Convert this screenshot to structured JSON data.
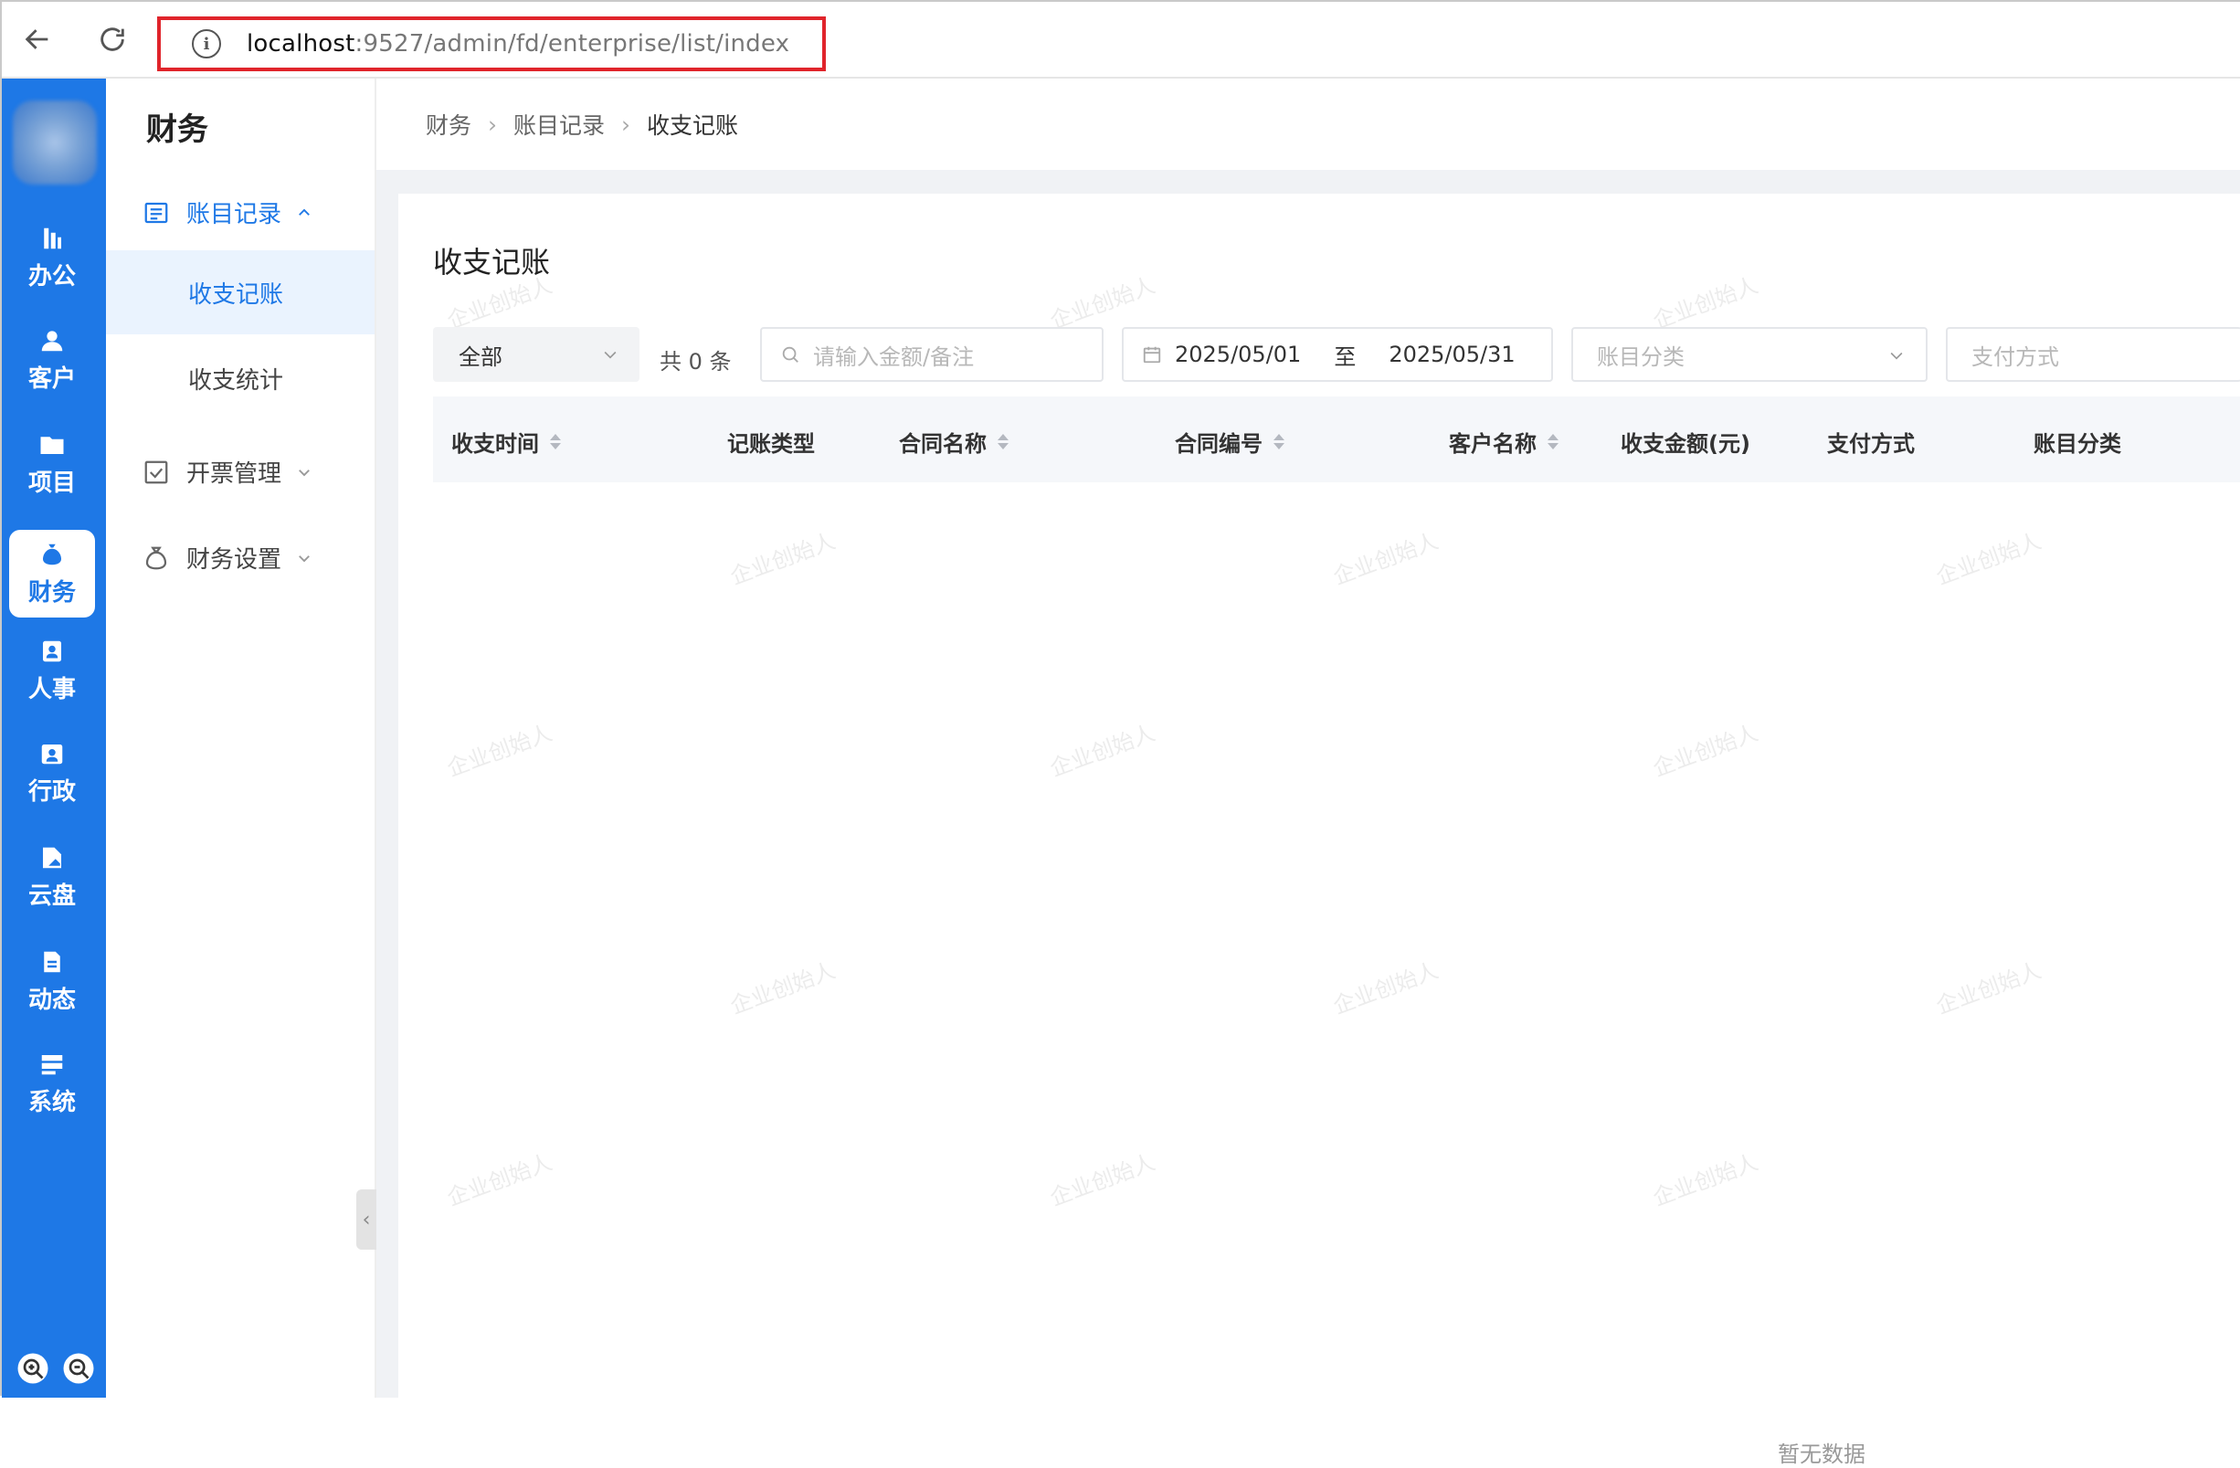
{
  "browser": {
    "url_host": "localhost",
    "url_path": ":9527/admin/fd/enterprise/list/index"
  },
  "rail": {
    "items": [
      {
        "label": "办公",
        "icon": "office-icon"
      },
      {
        "label": "客户",
        "icon": "customer-icon"
      },
      {
        "label": "项目",
        "icon": "project-icon"
      },
      {
        "label": "财务",
        "icon": "finance-icon",
        "active": true
      },
      {
        "label": "人事",
        "icon": "hr-icon"
      },
      {
        "label": "行政",
        "icon": "admin-icon"
      },
      {
        "label": "云盘",
        "icon": "cloud-disk-icon"
      },
      {
        "label": "动态",
        "icon": "activity-icon"
      },
      {
        "label": "系统",
        "icon": "system-icon"
      }
    ]
  },
  "sidebar": {
    "title": "财务",
    "groups": [
      {
        "label": "账目记录",
        "open": true,
        "children": [
          "收支记账",
          "收支统计"
        ]
      },
      {
        "label": "开票管理",
        "open": false
      },
      {
        "label": "财务设置",
        "open": false
      }
    ]
  },
  "breadcrumb": [
    "财务",
    "账目记录",
    "收支记账"
  ],
  "page": {
    "title": "收支记账",
    "filter_type": "全部",
    "count_text": "共 0 条",
    "search_placeholder": "请输入金额/备注",
    "date_start": "2025/05/01",
    "date_sep": "至",
    "date_end": "2025/05/31",
    "category_placeholder": "账目分类",
    "payment_placeholder": "支付方式",
    "empty_text": "暂无数据",
    "watermark": "企业创始人"
  },
  "table": {
    "columns": [
      "收支时间",
      "记账类型",
      "合同名称",
      "合同编号",
      "客户名称",
      "收支金额(元)",
      "支付方式",
      "账目分类"
    ]
  },
  "colors": {
    "accent": "#1e78e6",
    "highlight_border": "#e0242b"
  }
}
